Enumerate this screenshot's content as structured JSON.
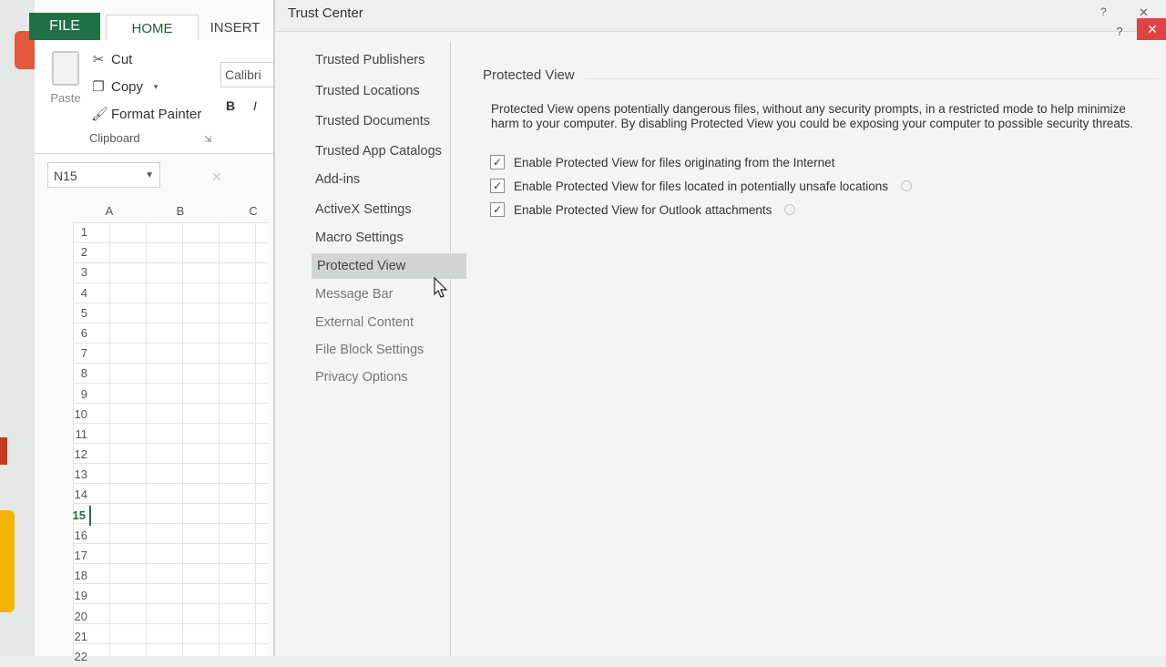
{
  "excel": {
    "tabs": {
      "file": "FILE",
      "home": "HOME",
      "insert": "INSERT"
    },
    "clipboard": {
      "paste": "Paste",
      "cut": "Cut",
      "copy": "Copy",
      "format_painter": "Format Painter",
      "group_label": "Clipboard"
    },
    "font_name": "Calibri",
    "bold": "B",
    "italic": "I",
    "name_box": "N15",
    "columns": [
      "A",
      "B",
      "C"
    ],
    "rows": [
      "1",
      "2",
      "3",
      "4",
      "5",
      "6",
      "7",
      "8",
      "9",
      "10",
      "11",
      "12",
      "13",
      "14",
      "15",
      "16",
      "17",
      "18",
      "19",
      "20",
      "21",
      "22"
    ],
    "selected_row": "15"
  },
  "dialog": {
    "title": "Trust Center",
    "help": "?",
    "close": "✕",
    "nav": [
      {
        "label": "Trusted Publishers"
      },
      {
        "label": "Trusted Locations"
      },
      {
        "label": "Trusted Documents"
      },
      {
        "label": "Trusted App Catalogs"
      },
      {
        "label": "Add-ins"
      },
      {
        "label": "ActiveX Settings"
      },
      {
        "label": "Macro Settings"
      },
      {
        "label": "Protected View"
      },
      {
        "label": "Message Bar"
      },
      {
        "label": "External Content"
      },
      {
        "label": "File Block Settings"
      },
      {
        "label": "Privacy Options"
      }
    ],
    "active_nav": "Protected View",
    "section_title": "Protected View",
    "description": "Protected View opens potentially dangerous files, without any security prompts, in a restricted mode to help minimize harm to your computer. By disabling Protected View you could be exposing your computer to possible security threats.",
    "options": [
      {
        "label": "Enable Protected View for files originating from the Internet",
        "checked": true
      },
      {
        "label": "Enable Protected View for files located in potentially unsafe locations",
        "checked": true
      },
      {
        "label": "Enable Protected View for Outlook attachments",
        "checked": true
      }
    ]
  },
  "colors": {
    "excel_green": "#1e7145",
    "close_red": "#e04343",
    "nav_active": "#d3d5d4"
  }
}
